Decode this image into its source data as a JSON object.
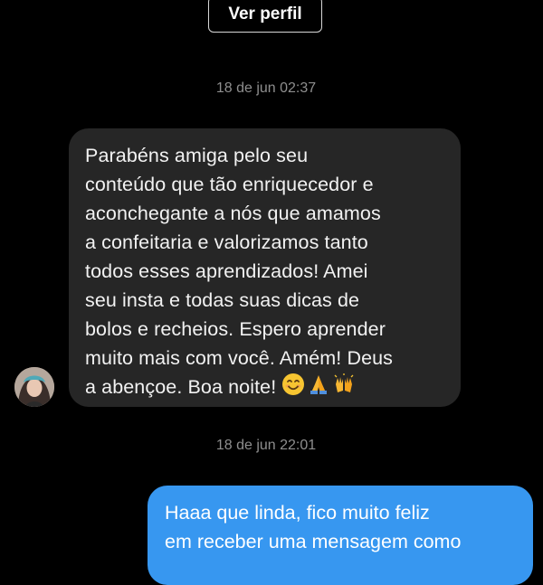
{
  "header": {
    "view_profile_label": "Ver perfil"
  },
  "conversation": {
    "timestamp_1": "18 de jun 02:37",
    "incoming_message": {
      "lines": [
        "Parabéns amiga pelo seu",
        "conteúdo que tão enriquecedor e",
        "aconchegante a nós que amamos",
        "a confeitaria e valorizamos tanto",
        "todos esses aprendizados! Amei",
        "seu insta e todas suas dicas de",
        "bolos e recheios. Espero aprender",
        "muito mais com você. Amém! Deus",
        "a abençoe. Boa noite!"
      ],
      "emojis": [
        "smiling-face-emoji",
        "folded-hands-emoji",
        "raising-hands-emoji"
      ]
    },
    "timestamp_2": "18 de jun 22:01",
    "outgoing_message": {
      "lines": [
        "Haaa que linda, fico muito feliz",
        "em receber uma mensagem como"
      ]
    }
  },
  "colors": {
    "background": "#000000",
    "incoming_bubble": "#262626",
    "outgoing_bubble": "#3797f0",
    "timestamp": "#8e8e8e",
    "emoji_yellow": "#f7c531"
  }
}
